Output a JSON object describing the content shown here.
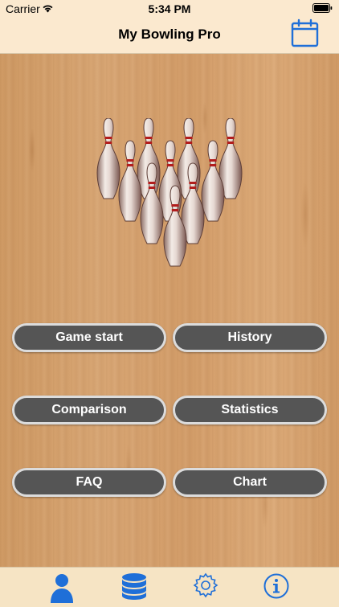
{
  "status_bar": {
    "carrier": "Carrier",
    "time": "5:34 PM"
  },
  "nav": {
    "title": "My Bowling Pro",
    "right_icon": "calendar-icon"
  },
  "menu": {
    "game_start": "Game start",
    "history": "History",
    "comparison": "Comparison",
    "statistics": "Statistics",
    "faq": "FAQ",
    "chart": "Chart"
  },
  "tabs": [
    {
      "icon": "person-icon",
      "active": true
    },
    {
      "icon": "database-icon",
      "active": false
    },
    {
      "icon": "gear-icon",
      "active": false
    },
    {
      "icon": "info-icon",
      "active": false
    }
  ],
  "colors": {
    "accent": "#1f6fd8",
    "bar_background": "#fbe9cf",
    "button_fill": "#555555",
    "button_border": "#dcdcdc"
  }
}
